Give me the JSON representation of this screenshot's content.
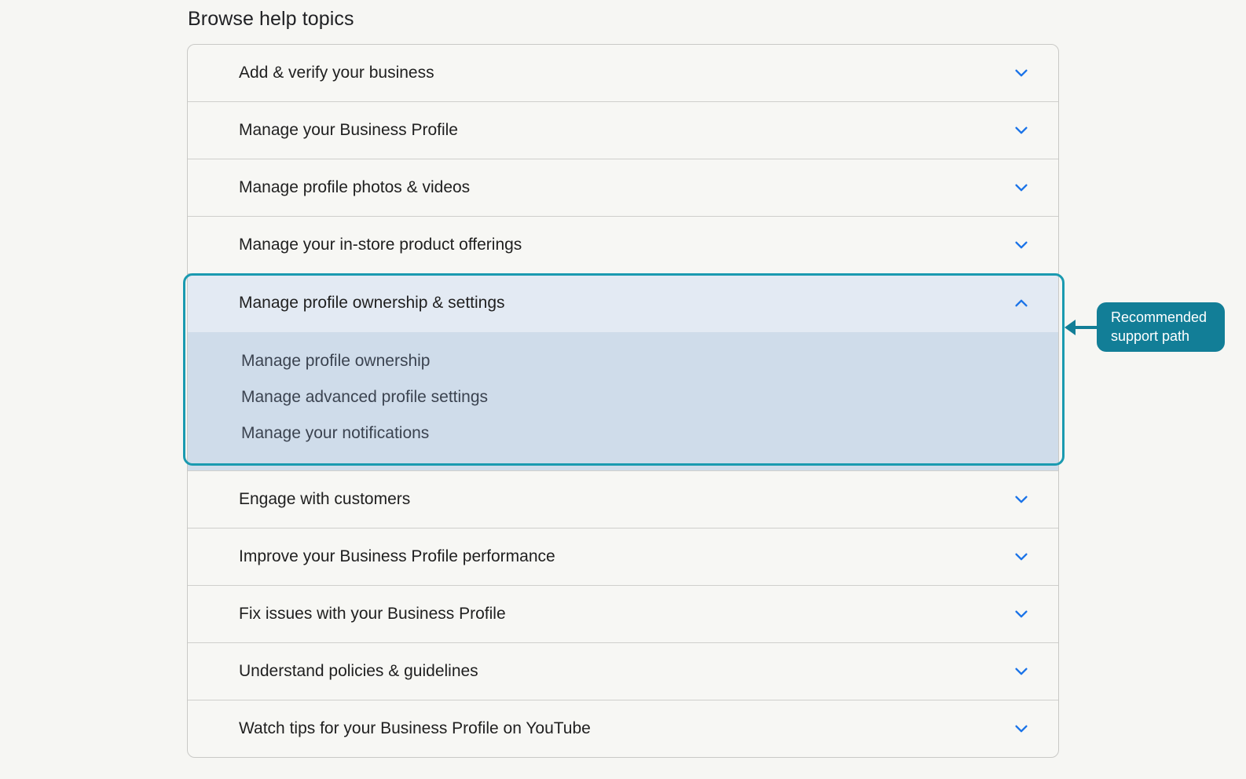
{
  "heading": "Browse help topics",
  "colors": {
    "accent_chevron": "#1a73e8",
    "highlight_border": "#1a9ab0",
    "callout_bg": "#127e97",
    "expanded_header_bg": "#e3eaf3",
    "expanded_body_bg": "#cfdcea"
  },
  "topics_before": [
    {
      "label": "Add & verify your business",
      "icon": "chevron-down-icon"
    },
    {
      "label": "Manage your Business Profile",
      "icon": "chevron-down-icon"
    },
    {
      "label": "Manage profile photos & videos",
      "icon": "chevron-down-icon"
    },
    {
      "label": "Manage your in-store product offerings",
      "icon": "chevron-down-icon"
    }
  ],
  "expanded_topic": {
    "label": "Manage profile ownership & settings",
    "icon": "chevron-up-icon",
    "links": [
      "Manage profile ownership",
      "Manage advanced profile settings",
      "Manage your notifications"
    ]
  },
  "topics_after": [
    {
      "label": "Engage with customers",
      "icon": "chevron-down-icon"
    },
    {
      "label": "Improve your Business Profile performance",
      "icon": "chevron-down-icon"
    },
    {
      "label": "Fix issues with your Business Profile",
      "icon": "chevron-down-icon"
    },
    {
      "label": "Understand policies & guidelines",
      "icon": "chevron-down-icon"
    },
    {
      "label": "Watch tips for your Business Profile on YouTube",
      "icon": "chevron-down-icon"
    }
  ],
  "callout": {
    "line1": "Recommended",
    "line2": "support path"
  }
}
